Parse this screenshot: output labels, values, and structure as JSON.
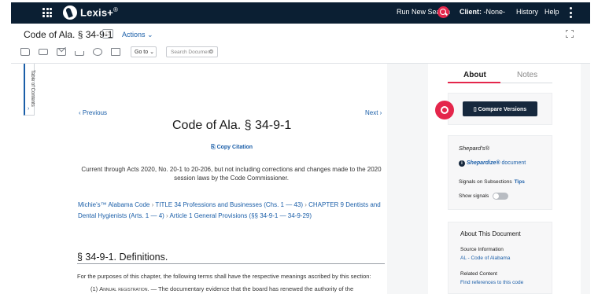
{
  "topnav": {
    "logo_text": "Lexis+",
    "logo_sup": "®",
    "run_search": "Run New Search",
    "client_label": "Client:",
    "client_value": "-None-",
    "history": "History",
    "help": "Help"
  },
  "doc_header": {
    "title": "Code of Ala. § 34-9-1",
    "actions": "Actions ⌄",
    "goto": "Go to ⌄",
    "search_placeholder": "Search Document"
  },
  "toc_label": "Table of Contents",
  "document": {
    "prev": "‹ Previous",
    "next": "Next ›",
    "title": "Code of Ala. § 34-9-1",
    "copy_citation": "Copy Citation",
    "currency": "Current through Acts 2020, No. 20-1 to 20-206, but not including corrections and changes made to the 2020 session laws by the Code Commissioner.",
    "breadcrumbs": [
      "Michie's™ Alabama Code",
      "TITLE 34 Professions and Businesses (Chs. 1 — 43)",
      "CHAPTER 9 Dentists and Dental Hygienists (Arts. 1 — 4)",
      "Article 1 General Provisions (§§ 34-9-1 — 34-9-29)"
    ],
    "section_heading": "§ 34-9-1. Definitions.",
    "intro": "For the purposes of this chapter, the following terms shall have the respective meanings ascribed by this section:",
    "item1_num": "(1)",
    "item1_term": "Annual registration.",
    "item1_text": " — The documentary evidence that the board has renewed the authority of the"
  },
  "right_panel": {
    "tab_about": "About",
    "tab_notes": "Notes",
    "compare_versions": "Compare Versions",
    "shepards_title": "Shepard's®",
    "shepardize_bold": "Shepardize®",
    "shepardize_rest": " document",
    "signals_on_subsections": "Signals on Subsections",
    "tips": "Tips",
    "show_signals": "Show signals",
    "about_title": "About This Document",
    "source_label": "Source Information",
    "source_link": "AL - Code of Alabama",
    "related_label": "Related Content",
    "related_link": "Find references to this code"
  },
  "colors": {
    "nav_bg": "#0b1f33",
    "accent_red": "#e4264b",
    "link_blue": "#1a5ea8",
    "button_dark": "#16283d"
  }
}
